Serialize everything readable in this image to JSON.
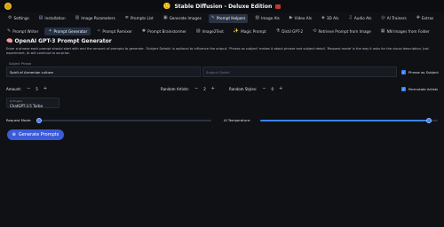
{
  "titlebar": {
    "title": "Stable Diffusion - Deluxe Edition",
    "title_emoji": "🙂",
    "logo_icon": "app-logo"
  },
  "main_tabs": [
    {
      "label": "Settings",
      "icon": "⚙"
    },
    {
      "label": "Installation",
      "icon": "▤"
    },
    {
      "label": "Image Parameters",
      "icon": "▥"
    },
    {
      "label": "Prompts List",
      "icon": "≣"
    },
    {
      "label": "Generate Images",
      "icon": "▣"
    },
    {
      "label": "Prompt Helpers",
      "icon": "✎",
      "active": true
    },
    {
      "label": "Image AIs",
      "icon": "▧"
    },
    {
      "label": "Video AIs",
      "icon": "▶"
    },
    {
      "label": "3D AIs",
      "icon": "◈"
    },
    {
      "label": "Audio AIs",
      "icon": "♫"
    },
    {
      "label": "AI Trainers",
      "icon": "◎"
    },
    {
      "label": "Extras",
      "icon": "✚"
    }
  ],
  "sub_tabs": [
    {
      "label": "Prompt Writer",
      "icon": "✎"
    },
    {
      "label": "Prompt Generator",
      "icon": "✦",
      "active": true
    },
    {
      "label": "Prompt Remixer",
      "icon": "✧"
    },
    {
      "label": "Prompt Brainstormer",
      "icon": "✺"
    },
    {
      "label": "Image2Text",
      "icon": "▨"
    },
    {
      "label": "Magic Prompt",
      "icon": "✨"
    },
    {
      "label": "Distil GPT-2",
      "icon": "⚗"
    },
    {
      "label": "Retrieve Prompt from Image",
      "icon": "⟲"
    },
    {
      "label": "NN Images from Folder",
      "icon": "▦"
    }
  ],
  "section": {
    "icon": "🧠",
    "title": "OpenAI GPT-3 Prompt Generator",
    "description": "Enter a phrase each prompt should start with and the amount of prompts to generate. 'Subject Details' is optional to influence the output. 'Phrase as subject' makes it about phrase and subject detail. 'Request mode' is the way it asks for the visual description. Just experiment, AI will continue to surprise."
  },
  "form": {
    "subject_phrase_label": "Subject Phrase",
    "subject_phrase_value": "Spirit of Armenian culture",
    "subject_detail_placeholder": "Subject Detail",
    "phrase_as_subject_label": "Phrase as Subject",
    "phrase_as_subject_checked": true,
    "amount_label": "Amount:",
    "amount_value": "5",
    "random_artists_label": "Random Artists:",
    "random_artists_value": "2",
    "random_styles_label": "Random Styles:",
    "random_styles_value": "0",
    "permutate_artists_label": "Permutate Artists",
    "permutate_artists_checked": true,
    "ai_engine_label": "AI Engine",
    "ai_engine_value": "ChatGPT-3.5 Turbo",
    "request_mode_label": "Request Mode:",
    "request_mode_fraction": 0.0,
    "ai_temperature_label": "AI Temperature:",
    "ai_temperature_fraction": 0.95,
    "minus": "−",
    "plus": "+"
  },
  "actions": {
    "generate_label": "Generate Prompts",
    "generate_icon": "⊕"
  },
  "colors": {
    "accent": "#3b82f6",
    "button": "#3b5bdb",
    "background": "#0f1115"
  }
}
